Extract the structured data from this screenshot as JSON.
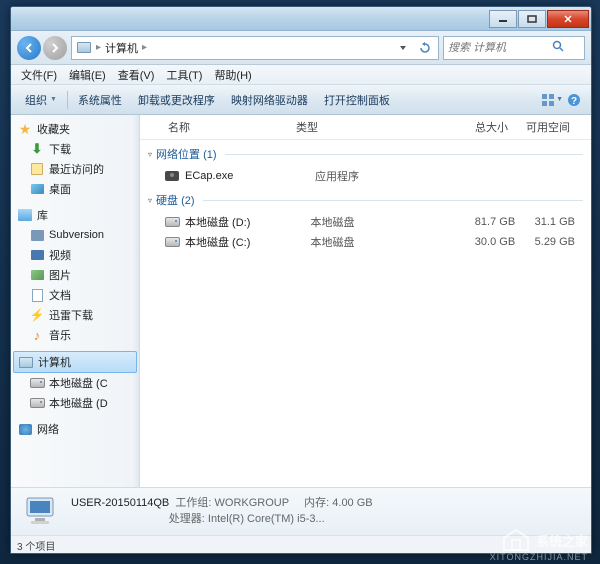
{
  "titlebar": {},
  "nav": {
    "breadcrumb_icon": "computer",
    "breadcrumb": "计算机",
    "search_placeholder": "搜索 计算机"
  },
  "menu": {
    "file": "文件(F)",
    "edit": "编辑(E)",
    "view": "查看(V)",
    "tools": "工具(T)",
    "help": "帮助(H)"
  },
  "toolbar": {
    "organize": "组织",
    "properties": "系统属性",
    "uninstall": "卸载或更改程序",
    "map_drive": "映射网络驱动器",
    "control_panel": "打开控制面板"
  },
  "columns": {
    "name": "名称",
    "type": "类型",
    "total_size": "总大小",
    "free_space": "可用空间"
  },
  "sidebar": {
    "favorites": "收藏夹",
    "downloads": "下载",
    "recent": "最近访问的",
    "desktop": "桌面",
    "libraries": "库",
    "subversion": "Subversion",
    "videos": "视频",
    "pictures": "图片",
    "documents": "文档",
    "thunder_dl": "迅雷下载",
    "music": "音乐",
    "computer": "计算机",
    "drive_c": "本地磁盘 (C",
    "drive_d": "本地磁盘 (D",
    "network": "网络"
  },
  "groups": {
    "network_location": "网络位置 (1)",
    "hard_drives": "硬盘 (2)"
  },
  "items": {
    "ecap": {
      "name": "ECap.exe",
      "type": "应用程序"
    },
    "drive_d": {
      "name": "本地磁盘 (D:)",
      "type": "本地磁盘",
      "size": "81.7 GB",
      "free": "31.1 GB"
    },
    "drive_c": {
      "name": "本地磁盘 (C:)",
      "type": "本地磁盘",
      "size": "30.0 GB",
      "free": "5.29 GB"
    }
  },
  "details": {
    "name": "USER-20150114QB",
    "workgroup_label": "工作组:",
    "workgroup": "WORKGROUP",
    "memory_label": "内存:",
    "memory": "4.00 GB",
    "processor_label": "处理器:",
    "processor": "Intel(R) Core(TM) i5-3..."
  },
  "status": {
    "items": "3 个项目"
  },
  "watermark": {
    "text": "系统之家",
    "url": "XITONGZHIJIA.NET"
  }
}
